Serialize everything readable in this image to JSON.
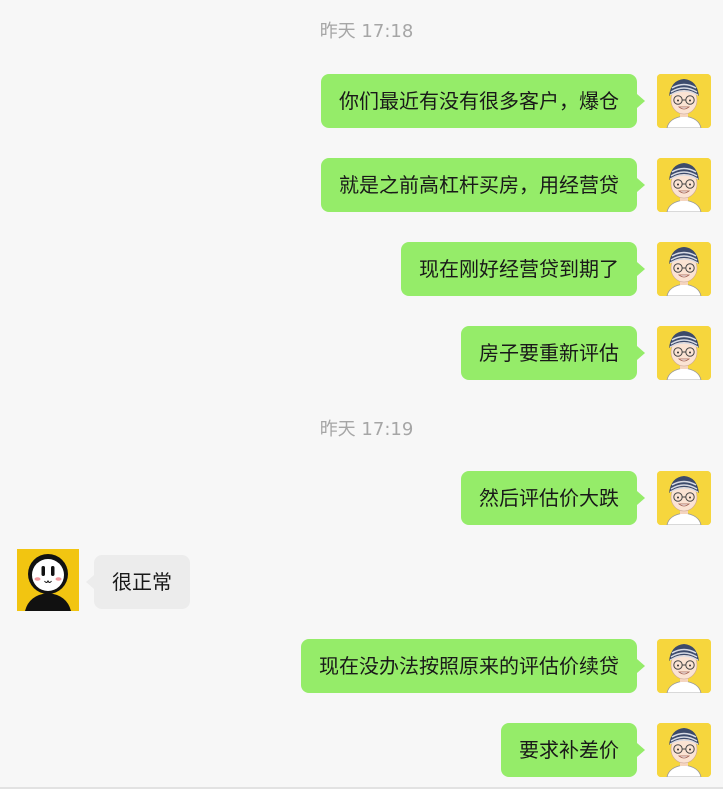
{
  "chat": {
    "timestamps": [
      "昨天 17:18",
      "昨天 17:19"
    ],
    "messages": [
      {
        "from": "me",
        "text": "你们最近有没有很多客户，爆仓"
      },
      {
        "from": "me",
        "text": "就是之前高杠杆买房，用经营贷"
      },
      {
        "from": "me",
        "text": "现在刚好经营贷到期了"
      },
      {
        "from": "me",
        "text": "房子要重新评估"
      },
      {
        "from": "me",
        "text": "然后评估价大跌"
      },
      {
        "from": "other",
        "text": "很正常"
      },
      {
        "from": "me",
        "text": "现在没办法按照原来的评估价续贷"
      },
      {
        "from": "me",
        "text": "要求补差价"
      }
    ]
  },
  "colors": {
    "outgoing_bubble": "#95ec69",
    "incoming_bubble": "#ececec",
    "timestamp": "#a6a6a6",
    "background": "#f7f7f7"
  },
  "icons": {
    "my_avatar": "cartoon-man-with-glasses-avatar-icon",
    "other_avatar": "cartoon-black-figure-avatar-icon"
  }
}
